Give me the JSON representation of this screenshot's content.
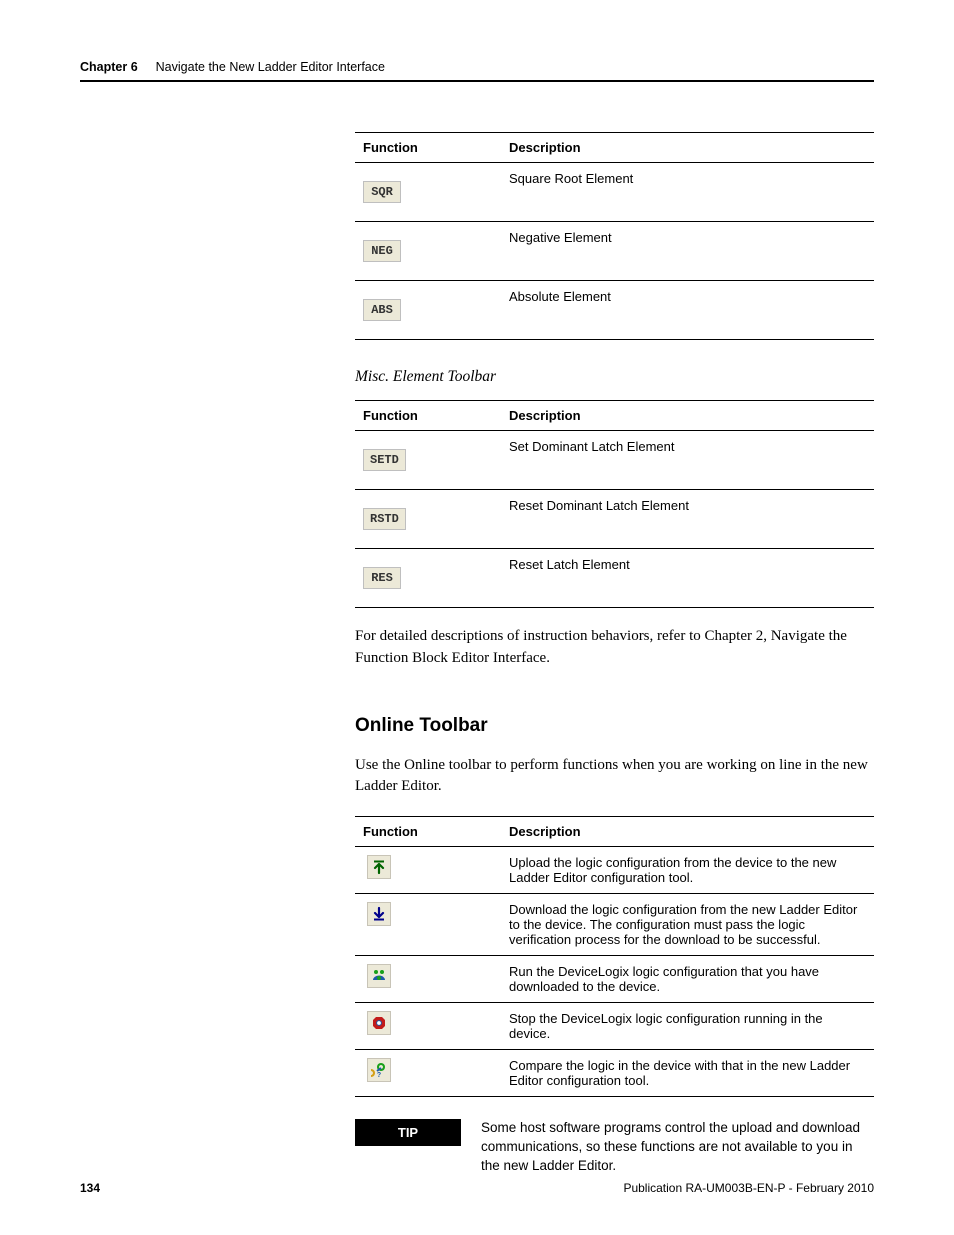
{
  "header": {
    "chapter": "Chapter 6",
    "title": "Navigate the New Ladder Editor Interface"
  },
  "table1": {
    "col1": "Function",
    "col2": "Description",
    "rows": [
      {
        "fn": "SQR",
        "desc": "Square Root Element"
      },
      {
        "fn": "NEG",
        "desc": "Negative Element"
      },
      {
        "fn": "ABS",
        "desc": "Absolute Element"
      }
    ]
  },
  "subhead1": "Misc. Element Toolbar",
  "table2": {
    "col1": "Function",
    "col2": "Description",
    "rows": [
      {
        "fn": "SETD",
        "desc": "Set Dominant Latch Element"
      },
      {
        "fn": "RSTD",
        "desc": "Reset Dominant Latch Element"
      },
      {
        "fn": "RES",
        "desc": "Reset Latch Element"
      }
    ]
  },
  "para1": "For detailed descriptions of instruction behaviors, refer to Chapter 2, Navigate the Function Block Editor Interface.",
  "h2": "Online Toolbar",
  "para2": "Use the Online toolbar to perform functions when you are working on line in the new Ladder Editor.",
  "table3": {
    "col1": "Function",
    "col2": "Description",
    "rows": [
      {
        "icon": "upload",
        "desc": "Upload the logic configuration from the device to the new Ladder Editor configuration tool."
      },
      {
        "icon": "download",
        "desc": "Download the logic configuration from the new Ladder Editor to the device. The configuration must pass the logic verification process for the download to be successful."
      },
      {
        "icon": "run",
        "desc": "Run the DeviceLogix logic configuration that you have downloaded to the device."
      },
      {
        "icon": "stop",
        "desc": "Stop the DeviceLogix logic configuration running in the device."
      },
      {
        "icon": "compare",
        "desc": "Compare the logic in the device with that in the new Ladder Editor configuration tool."
      }
    ]
  },
  "tip": {
    "label": "TIP",
    "text": "Some host software programs control the upload and download communications, so these functions are not available to you in the new Ladder Editor."
  },
  "footer": {
    "page": "134",
    "pub": "Publication RA-UM003B-EN-P - February 2010"
  }
}
